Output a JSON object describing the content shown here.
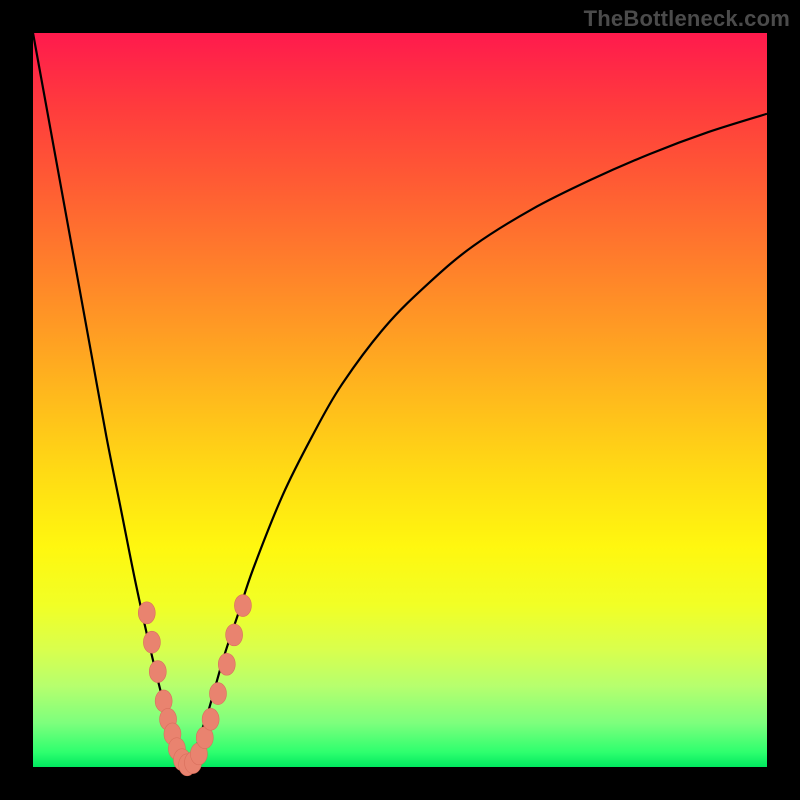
{
  "watermark": "TheBottleneck.com",
  "colors": {
    "frame": "#000000",
    "curve_stroke": "#000000",
    "marker_fill": "#e9836f",
    "marker_stroke": "#d96f5c",
    "gradient_top": "#ff1a4d",
    "gradient_bottom": "#00e85f"
  },
  "chart_data": {
    "type": "line",
    "title": "",
    "xlabel": "",
    "ylabel": "",
    "xlim": [
      0,
      100
    ],
    "ylim": [
      0,
      100
    ],
    "series": [
      {
        "name": "bottleneck-curve",
        "x": [
          0,
          2,
          4,
          6,
          8,
          10,
          12,
          14,
          16,
          18,
          19,
          20,
          21,
          22,
          23,
          24,
          26,
          28,
          30,
          34,
          38,
          42,
          48,
          54,
          60,
          68,
          76,
          84,
          92,
          100
        ],
        "y": [
          100,
          89,
          78,
          67,
          56,
          45,
          35,
          25,
          16,
          8,
          5,
          2,
          0,
          2,
          5,
          8,
          15,
          21,
          27,
          37,
          45,
          52,
          60,
          66,
          71,
          76,
          80,
          83.5,
          86.5,
          89
        ]
      }
    ],
    "markers": [
      {
        "x": 15.5,
        "y": 21
      },
      {
        "x": 16.2,
        "y": 17
      },
      {
        "x": 17.0,
        "y": 13
      },
      {
        "x": 17.8,
        "y": 9
      },
      {
        "x": 18.4,
        "y": 6.5
      },
      {
        "x": 19.0,
        "y": 4.5
      },
      {
        "x": 19.6,
        "y": 2.5
      },
      {
        "x": 20.3,
        "y": 1.0
      },
      {
        "x": 21.0,
        "y": 0.3
      },
      {
        "x": 21.8,
        "y": 0.6
      },
      {
        "x": 22.6,
        "y": 1.8
      },
      {
        "x": 23.4,
        "y": 4.0
      },
      {
        "x": 24.2,
        "y": 6.5
      },
      {
        "x": 25.2,
        "y": 10.0
      },
      {
        "x": 26.4,
        "y": 14.0
      },
      {
        "x": 27.4,
        "y": 18.0
      },
      {
        "x": 28.6,
        "y": 22.0
      }
    ]
  }
}
